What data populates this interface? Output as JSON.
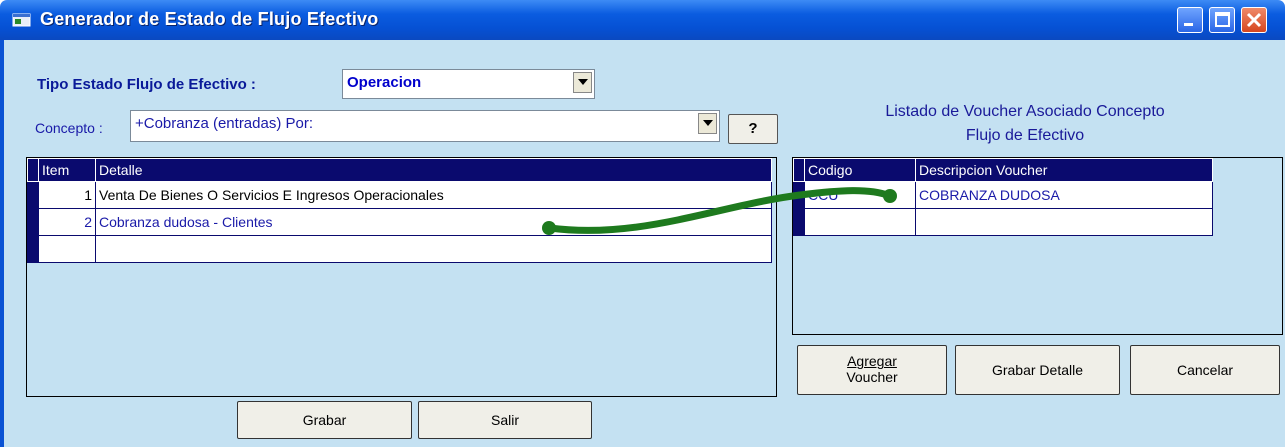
{
  "window": {
    "title": "Generador de Estado de Flujo Efectivo"
  },
  "tipo": {
    "label": "Tipo  Estado Flujo de Efectivo :",
    "value": "Operacion"
  },
  "concepto": {
    "label": "Concepto :",
    "value": "+Cobranza (entradas) Por:",
    "help_label": "?"
  },
  "detail_grid": {
    "columns": [
      "Item",
      "Detalle"
    ],
    "rows": [
      {
        "item": "1",
        "detalle": "Venta De Bienes O Servicios E Ingresos Operacionales"
      },
      {
        "item": "2",
        "detalle": "Cobranza dudosa - Clientes"
      }
    ]
  },
  "voucher": {
    "heading_line1": "Listado de Voucher Asociado Concepto",
    "heading_line2": "Flujo de Efectivo",
    "columns": [
      "Codigo",
      "Descripcion Voucher"
    ],
    "rows": [
      {
        "codigo": "CCU",
        "descripcion": "COBRANZA DUDOSA"
      }
    ]
  },
  "buttons": {
    "grabar": "Grabar",
    "salir": "Salir",
    "agregar_line1": "Agregar",
    "agregar_line2": "Voucher",
    "grabar_detalle": "Grabar Detalle",
    "cancelar": "Cancelar"
  },
  "colors": {
    "titlebar": "#0a5ce0",
    "panel": "#c4e1f2",
    "grid_header": "#0a0a6e",
    "connector": "#1e7a1e"
  }
}
